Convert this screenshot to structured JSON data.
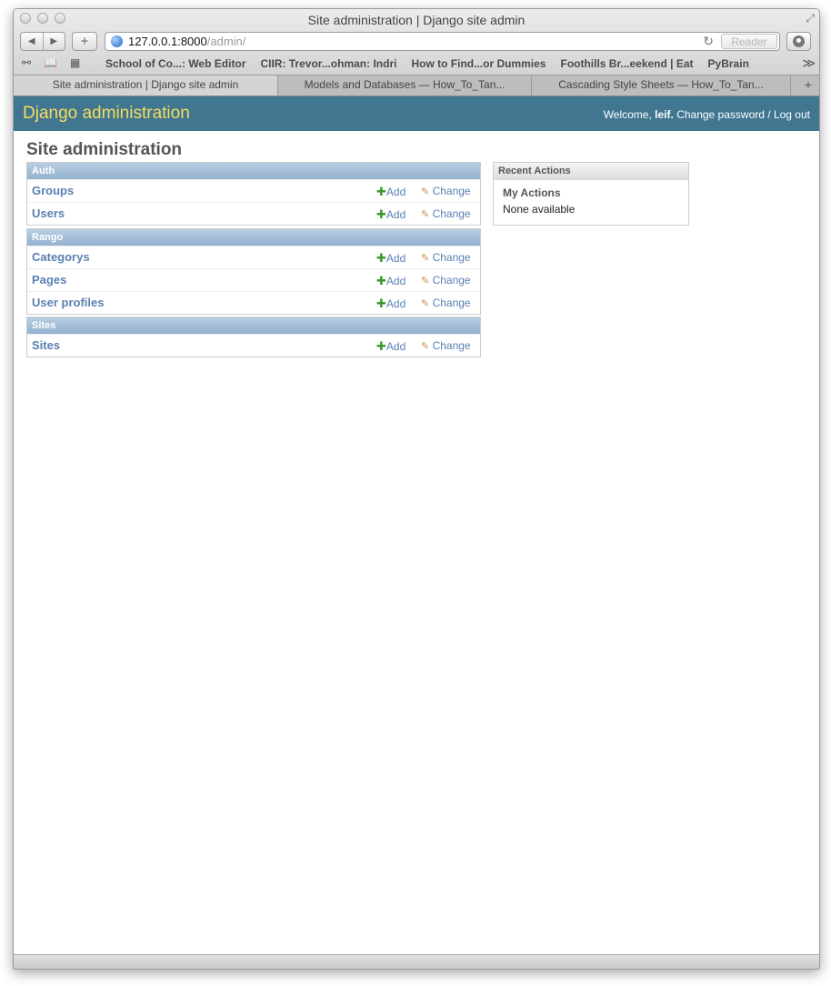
{
  "window": {
    "title": "Site administration | Django site admin"
  },
  "toolbar": {
    "back_icon": "◀",
    "forward_icon": "▶",
    "add_icon": "+",
    "url_host": "127.0.0.1:8000",
    "url_path": "/admin/",
    "reload_icon": "↻",
    "reader_label": "Reader"
  },
  "bookmarks": [
    "School of Co...: Web Editor",
    "CIIR: Trevor...ohman: Indri",
    "How to Find...or Dummies",
    "Foothills Br...eekend | Eat",
    "PyBrain"
  ],
  "bookmarks_more": "≫",
  "tabs": [
    "Site administration | Django site admin",
    "Models and Databases — How_To_Tan...",
    "Cascading Style Sheets — How_To_Tan..."
  ],
  "header": {
    "branding": "Django administration",
    "welcome": "Welcome,",
    "username": "leif.",
    "change_password": "Change password",
    "separator": "/",
    "logout": "Log out"
  },
  "page_title": "Site administration",
  "links": {
    "add": "Add",
    "change": "Change"
  },
  "apps": [
    {
      "name": "Auth",
      "models": [
        "Groups",
        "Users"
      ]
    },
    {
      "name": "Rango",
      "models": [
        "Categorys",
        "Pages",
        "User profiles"
      ]
    },
    {
      "name": "Sites",
      "models": [
        "Sites"
      ]
    }
  ],
  "recent_actions": {
    "caption": "Recent Actions",
    "heading": "My Actions",
    "empty": "None available"
  },
  "colors": {
    "header_bg": "#417690",
    "branding": "#f5dd5d",
    "link": "#5b80b2",
    "add_icon": "#3b9a2a"
  }
}
